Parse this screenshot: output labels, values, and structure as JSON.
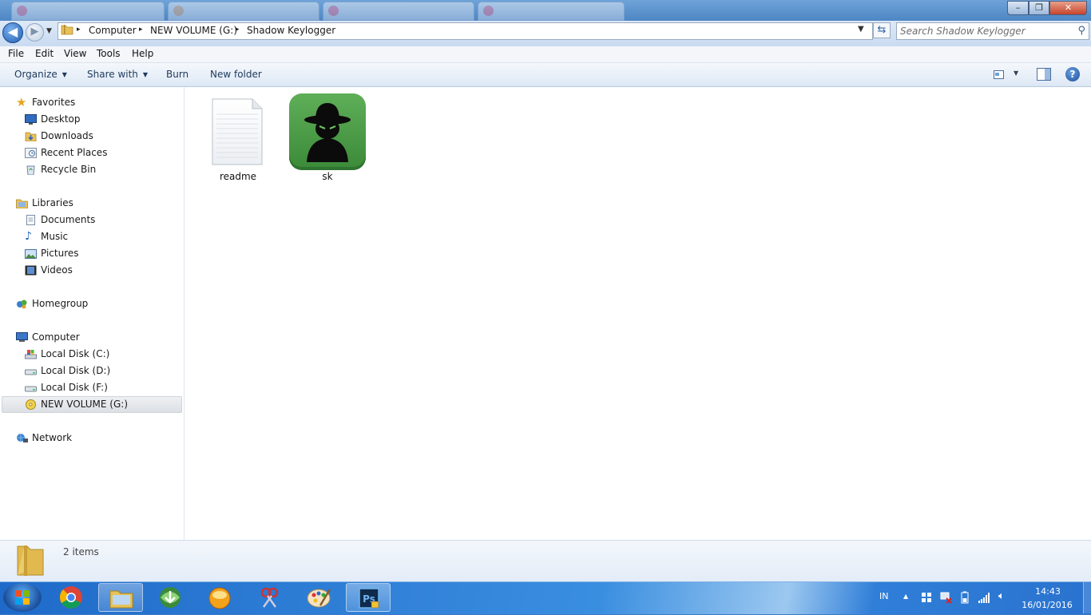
{
  "titlebar": {
    "tabs": [
      "",
      "",
      "",
      ""
    ],
    "minimize_glyph": "–",
    "maximize_glyph": "❐",
    "close_glyph": "✕"
  },
  "address": {
    "breadcrumbs": [
      "Computer",
      "NEW VOLUME (G:)",
      "Shadow Keylogger"
    ],
    "separator": "▸",
    "search_placeholder": "Search Shadow Keylogger"
  },
  "menubar": {
    "items": [
      "File",
      "Edit",
      "View",
      "Tools",
      "Help"
    ]
  },
  "commandbar": {
    "organize": "Organize",
    "share_with": "Share with",
    "burn": "Burn",
    "new_folder": "New folder",
    "dropdown_glyph": "▼"
  },
  "navpane": {
    "favorites": {
      "label": "Favorites",
      "items": [
        "Desktop",
        "Downloads",
        "Recent Places",
        "Recycle Bin"
      ]
    },
    "libraries": {
      "label": "Libraries",
      "items": [
        "Documents",
        "Music",
        "Pictures",
        "Videos"
      ]
    },
    "homegroup": {
      "label": "Homegroup"
    },
    "computer": {
      "label": "Computer",
      "items": [
        "Local Disk (C:)",
        "Local Disk (D:)",
        "Local Disk (F:)",
        "NEW VOLUME (G:)"
      ]
    },
    "network": {
      "label": "Network"
    },
    "selected": "NEW VOLUME (G:)"
  },
  "files": [
    {
      "name": "readme",
      "icon": "text-file-icon"
    },
    {
      "name": "sk",
      "icon": "spy-app-icon"
    }
  ],
  "details": {
    "items_count": "2 items"
  },
  "taskbar": {
    "apps": [
      "chrome-icon",
      "explorer-icon",
      "download-manager-icon",
      "media-player-icon",
      "snipping-tool-icon",
      "paint-icon",
      "photoshop-icon"
    ],
    "active_app": "photoshop-icon",
    "language": "IN",
    "time": "14:43",
    "date": "16/01/2016"
  },
  "colors": {
    "taskbar": "#2f7ed8",
    "sk_icon_green": "#4a9e45",
    "selection": "#dcdfe4"
  }
}
